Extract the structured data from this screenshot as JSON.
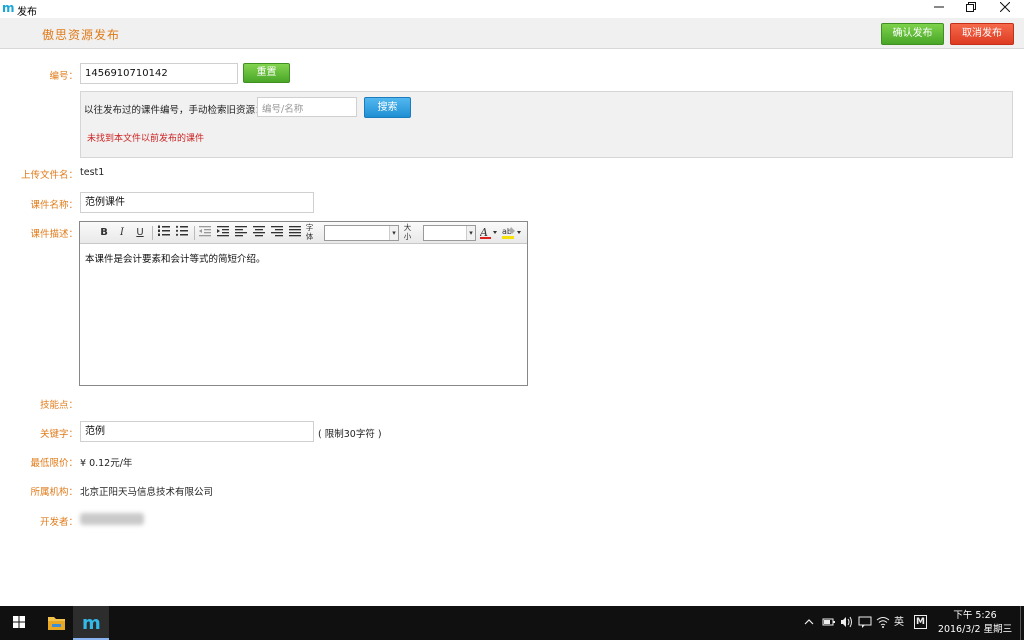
{
  "window": {
    "title": "发布",
    "logo": "m"
  },
  "header": {
    "title": "傲思资源发布",
    "confirm_label": "确认发布",
    "cancel_label": "取消发布"
  },
  "form": {
    "number_label": "编号：",
    "number_value": "1456910710142",
    "reset_label": "重置",
    "search_hint": "以往发布过的课件编号，手动检索旧资源：",
    "search_placeholder": "编号/名称",
    "search_label": "搜索",
    "not_found_text": "未找到本文件以前发布的课件",
    "filename_label": "上传文件名：",
    "filename_value": "test1",
    "course_name_label": "课件名称：",
    "course_name_value": "范例课件",
    "desc_label": "课件描述：",
    "desc_value": "本课件是会计要素和会计等式的简短介绍。",
    "skill_label": "技能点：",
    "keyword_label": "关键字：",
    "keyword_value": "范例",
    "keyword_hint": "( 限制30字符 )",
    "min_price_label": "最低限价：",
    "min_price_value": "¥ 0.12元/年",
    "org_label": "所属机构：",
    "org_value": "北京正阳天马信息技术有限公司",
    "developer_label": "开发者："
  },
  "editor_toolbar": {
    "bold": "B",
    "italic": "I",
    "underline": "U",
    "font_label_top": "字",
    "font_label_bottom": "体",
    "size_label_top": "大",
    "size_label_bottom": "小",
    "icons": [
      "bold-icon",
      "italic-icon",
      "underline-icon",
      "ordered-list-icon",
      "unordered-list-icon",
      "outdent-icon",
      "indent-icon",
      "align-left-icon",
      "align-center-icon",
      "align-right-icon",
      "justify-icon",
      "font-color-icon",
      "highlight-icon"
    ]
  },
  "taskbar": {
    "ime": "英",
    "time": "下午 5:26",
    "date": "2016/3/2 星期三",
    "app_m": "M"
  },
  "colors": {
    "label_orange": "#e07b1a",
    "confirm_green": "#4aa628",
    "cancel_red": "#dd3b22",
    "search_blue": "#1f8fd3",
    "error_red": "#cc2222"
  }
}
